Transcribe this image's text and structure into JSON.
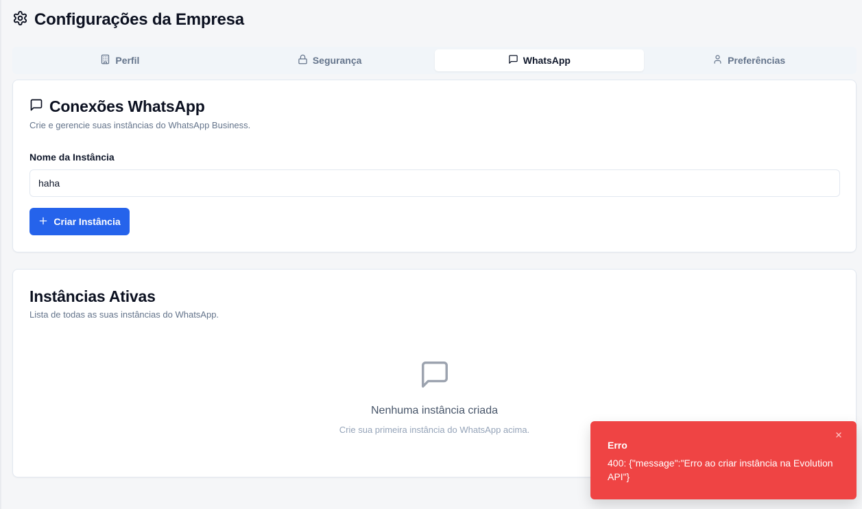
{
  "page": {
    "title": "Configurações da Empresa",
    "icon": "gear-icon"
  },
  "tabs": [
    {
      "label": "Perfil",
      "icon": "building-icon",
      "active": false
    },
    {
      "label": "Segurança",
      "icon": "lock-icon",
      "active": false
    },
    {
      "label": "WhatsApp",
      "icon": "message-square-icon",
      "active": true
    },
    {
      "label": "Preferências",
      "icon": "user-icon",
      "active": false
    }
  ],
  "connections": {
    "title": "Conexões WhatsApp",
    "description": "Crie e gerencie suas instâncias do WhatsApp Business.",
    "field_label": "Nome da Instância",
    "input_value": "haha",
    "create_button": "Criar Instância"
  },
  "instances": {
    "title": "Instâncias Ativas",
    "description": "Lista de todas as suas instâncias do WhatsApp.",
    "empty_title": "Nenhuma instância criada",
    "empty_subtitle": "Crie sua primeira instância do WhatsApp acima."
  },
  "toast": {
    "title": "Erro",
    "message": "400: {\"message\":\"Erro ao criar instância na Evolution API\"}"
  },
  "colors": {
    "accent": "#2563eb",
    "error": "#ef4444",
    "muted": "#64748b"
  }
}
